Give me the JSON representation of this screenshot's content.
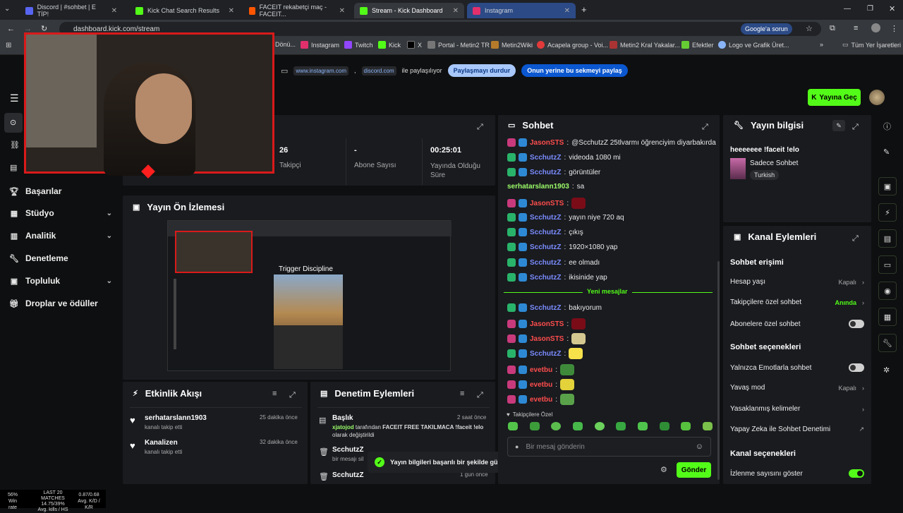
{
  "browser": {
    "tabs": [
      {
        "title": "Discord | #sohbet | E TİP!",
        "active": false,
        "color": "#5865f2"
      },
      {
        "title": "Kick Chat Search Results",
        "active": false,
        "color": "#53fc18"
      },
      {
        "title": "FACEIT rekabetçi maç - FACEIT...",
        "active": false,
        "color": "#ff5500"
      },
      {
        "title": "Stream - Kick Dashboard",
        "active": true,
        "color": "#53fc18"
      },
      {
        "title": "Instagram",
        "active": false,
        "color": "#e1306c"
      }
    ],
    "url": "dashboard.kick.com/stream",
    "google_btn": "Google'a sorun",
    "bookmarks": [
      "Dönü...",
      "Instagram",
      "Twitch",
      "Kick",
      "X",
      "Portal - Metin2 TR",
      "Metin2Wiki",
      "Acapela group - Voi...",
      "Metin2 Kral Yakalar...",
      "Efektler",
      "Logo ve Grafik Üret..."
    ],
    "all_bookmarks": "Tüm Yer İşaretleri",
    "share": {
      "site1": "www.instagram.com",
      "sep": ",",
      "site2": "discord.com",
      "text": "ile paylaşılıyor",
      "stop_btn": "Paylaşmayı durdur",
      "share_tab_btn": "Onun yerine bu sekmeyi paylaş"
    }
  },
  "header": {
    "go_live": "Yayına Geç"
  },
  "sidebar": {
    "items": [
      {
        "label": "Başarılar",
        "icon": "trophy-icon",
        "chevron": false
      },
      {
        "label": "Stüdyo",
        "icon": "studio-icon",
        "chevron": true
      },
      {
        "label": "Analitik",
        "icon": "analytics-icon",
        "chevron": true
      },
      {
        "label": "Denetleme",
        "icon": "wrench-icon",
        "chevron": false
      },
      {
        "label": "Topluluk",
        "icon": "community-icon",
        "chevron": true
      },
      {
        "label": "Droplar ve ödüller",
        "icon": "gift-icon",
        "chevron": false
      }
    ]
  },
  "stats": [
    {
      "value": "26",
      "label": "Takipçi"
    },
    {
      "value": "-",
      "label": "Abone Sayısı"
    },
    {
      "value": "00:25:01",
      "label": "Yayında Olduğu Süre"
    }
  ],
  "preview": {
    "title": "Yayın Ön İzlemesi",
    "overlay_text": "Trigger Discipline"
  },
  "activity": {
    "title": "Etkinlik Akışı",
    "items": [
      {
        "user": "serhatarslann1903",
        "desc": "kanalı takip etti",
        "time": "25 dakika önce"
      },
      {
        "user": "Kanalizen",
        "desc": "kanalı takip etti",
        "time": "32 dakika önce"
      }
    ]
  },
  "moderation": {
    "title": "Denetim Eylemleri",
    "items": [
      {
        "head": "Başlık",
        "time": "2 saat önce",
        "actor": "xjatojod",
        "text1": "tarafından",
        "text2": "FACEIT FREE TAKILMACA !faceit !elo",
        "text3": "olarak değiştirildi"
      },
      {
        "head": "ScchutzZ",
        "time": "",
        "text1": "bir mesajı sil"
      },
      {
        "head": "ScchutzZ",
        "time": "1 gün önce"
      }
    ]
  },
  "toast": "Yayın bilgileri başarılı bir şekilde güncellendi.",
  "chat": {
    "title": "Sohbet",
    "messages": [
      {
        "user": "JasonSTS",
        "text": "@ScchutzZ 25tlvarmı öğrenciyim diyarbakırda",
        "color": "red",
        "badge": "b-pink"
      },
      {
        "user": "ScchutzZ",
        "text": "videoda 1080 mi",
        "color": "blue",
        "badge": "b-green"
      },
      {
        "user": "ScchutzZ",
        "text": "görüntüler",
        "color": "blue",
        "badge": "b-green"
      },
      {
        "user": "serhatarslann1903",
        "text": "sa",
        "color": "green",
        "badge": ""
      },
      {
        "user": "JasonSTS",
        "text": "",
        "color": "red",
        "badge": "b-pink",
        "emote": "#7a0c18"
      },
      {
        "user": "ScchutzZ",
        "text": "yayın niye 720 aq",
        "color": "blue",
        "badge": "b-green"
      },
      {
        "user": "ScchutzZ",
        "text": "çıkış",
        "color": "blue",
        "badge": "b-green"
      },
      {
        "user": "ScchutzZ",
        "text": "1920×1080 yap",
        "color": "blue",
        "badge": "b-green"
      },
      {
        "user": "ScchutzZ",
        "text": "ee olmadı",
        "color": "blue",
        "badge": "b-green"
      },
      {
        "user": "ScchutzZ",
        "text": "ikisinide yap",
        "color": "blue",
        "badge": "b-green"
      }
    ],
    "new_label": "Yeni mesajlar",
    "new_messages": [
      {
        "user": "ScchutzZ",
        "text": "bakıyorum",
        "color": "blue",
        "badge": "b-green"
      },
      {
        "user": "JasonSTS",
        "text": "",
        "color": "red",
        "badge": "b-pink",
        "emote": "#7a0c18"
      },
      {
        "user": "JasonSTS",
        "text": "",
        "color": "red",
        "badge": "b-pink",
        "emote": "#d4c890"
      },
      {
        "user": "ScchutzZ",
        "text": "",
        "color": "blue",
        "badge": "b-green",
        "emote": "#f7e14b"
      },
      {
        "user": "evetbu",
        "text": "",
        "color": "red",
        "badge": "b-pink",
        "emote": "#3e8a3a"
      },
      {
        "user": "evetbu",
        "text": "",
        "color": "red",
        "badge": "b-pink",
        "emote": "#e3d23a"
      },
      {
        "user": "evetbu",
        "text": "",
        "color": "red",
        "badge": "b-pink",
        "emote": "#5aa24a"
      }
    ],
    "followers_only": "Takipçilere Özel",
    "input_placeholder": "Bir mesaj gönderin",
    "send": "Gönder"
  },
  "stream_info": {
    "title": "Yayın bilgisi",
    "stream_title": "heeeeeee !faceit !elo",
    "category": "Sadece Sohbet",
    "tag": "Turkish"
  },
  "channel_actions": {
    "title": "Kanal Eylemleri",
    "chat_access": "Sohbet erişimi",
    "account_age": {
      "label": "Hesap yaşı",
      "value": "Kapalı"
    },
    "followers_only": {
      "label": "Takipçilere özel sohbet",
      "value": "Anında"
    },
    "subs_only": {
      "label": "Abonelere özel sohbet"
    },
    "chat_options": "Sohbet seçenekleri",
    "emote_only": {
      "label": "Yalnızca Emotlarla sohbet"
    },
    "slow_mode": {
      "label": "Yavaş mod",
      "value": "Kapalı"
    },
    "banned_words": {
      "label": "Yasaklanmış kelimeler"
    },
    "ai_mod": {
      "label": "Yapay Zeka ile Sohbet Denetimi"
    },
    "channel_options": "Kanal seçenekleri",
    "show_viewers": {
      "label": "İzlenme sayısını göster"
    }
  },
  "taskbar": {
    "c1": "56%",
    "c1b": "Win rate",
    "c2": "LAST 20 MATCHES",
    "c2b": "14.75/39%",
    "c2c": "Avg. kills / HS",
    "c3": "0.87/0.68",
    "c3b": "Avg. K/D / K/R"
  }
}
